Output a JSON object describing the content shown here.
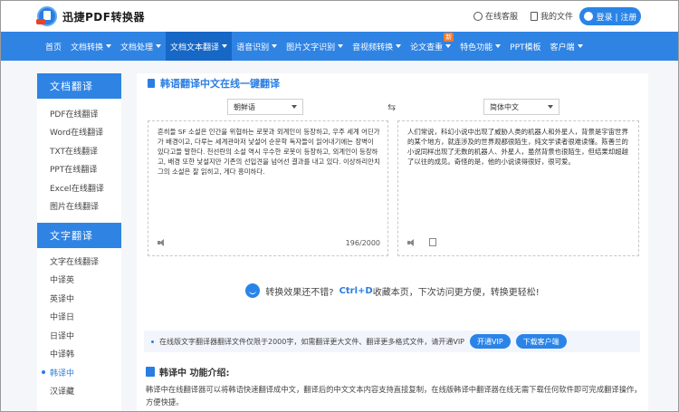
{
  "header": {
    "logo_text": "迅捷PDF转换器",
    "online_service": "在线客服",
    "my_files": "我的文件",
    "login_label": "登录 | 注册"
  },
  "nav": {
    "items": [
      {
        "label": "首页",
        "caret": false
      },
      {
        "label": "文档转换",
        "caret": true
      },
      {
        "label": "文档处理",
        "caret": true
      },
      {
        "label": "文档文本翻译",
        "caret": true
      },
      {
        "label": "语音识别",
        "caret": true
      },
      {
        "label": "图片文字识别",
        "caret": true
      },
      {
        "label": "音视频转换",
        "caret": true
      },
      {
        "label": "论文查重",
        "caret": true
      },
      {
        "label": "特色功能",
        "caret": true
      },
      {
        "label": "PPT模板",
        "caret": false
      },
      {
        "label": "客户端",
        "caret": true
      }
    ],
    "new_badge": "新"
  },
  "sidebar": {
    "doc_translate_title": "文档翻译",
    "doc_translate_items": [
      "PDF在线翻译",
      "Word在线翻译",
      "TXT在线翻译",
      "PPT在线翻译",
      "Excel在线翻译",
      "图片在线翻译"
    ],
    "text_translate_title": "文字翻译",
    "text_translate_items": [
      "文字在线翻译",
      "中译英",
      "英译中",
      "中译日",
      "日译中",
      "中译韩",
      "韩译中",
      "汉译藏"
    ]
  },
  "main": {
    "title": "韩语翻译中文在线一键翻译",
    "source_lang": "朝鲜语",
    "target_lang": "简体中文",
    "source_text": "흔히들 SF 소설은 인간을 위협하는 로봇과 외계인이 등장하고, 우주 세계 어딘가가 배경이고, 다루는 세계관마저 낯설어 순문학 독자들이 읽어내기에는 장벽이 있다고들 말한다. 천선란의 소설 역시 우수한 로봇이 등장하고, 외계인이 등장하고, 배경 또한 낯설지만 기존의 선입견을 넘어선 결과를 내고 있다. 이상하리만치 그의 소설은 잘 읽히고, 게다 흥미하다.",
    "target_text": "人们常说，科幻小说中出现了威胁人类的机器人和外星人，背景是宇宙世界的某个地方，就连涉及的世界观都很陌生，纯文学读者很难读懂。陈善兰的小说同样出现了无数的机器人、外星人，虽然背景也很陌生，但结果却超越了以往的成见。奇怪的是，他的小说读得很好，很可爱。",
    "char_counter": "196/2000"
  },
  "promo": {
    "before": "转换效果还不错?",
    "highlight": "Ctrl+D",
    "after": "收藏本页，下次访问更方便，转换更轻松!"
  },
  "notice": {
    "text": "在线版文字翻译器翻译文件仅限于2000字，如需翻译更大文件、翻译更多格式文件，请开通VIP",
    "vip_button": "开通VIP",
    "download_button": "下载客户端"
  },
  "intro": {
    "title": "韩译中 功能介绍:",
    "body": "韩译中在线翻译器可以将韩语快速翻译成中文，翻译后的中文文本内容支持直接复制，在线版韩译中翻译器在线无需下载任何软件即可完成翻译操作，方便快捷。"
  },
  "colors": {
    "brand_blue": "#2f83e3",
    "nav_active": "#1667c6",
    "badge_orange": "#f07a2d"
  }
}
